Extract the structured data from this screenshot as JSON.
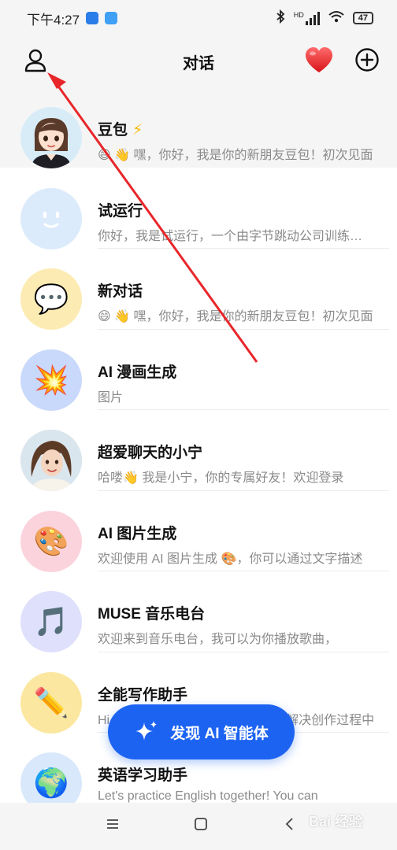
{
  "status_bar": {
    "time": "下午4:27",
    "network_label": "HD",
    "battery": "47"
  },
  "header": {
    "title": "对话"
  },
  "chats": [
    {
      "name": "豆包",
      "badge": "⚡",
      "preview": "😄 👋 嘿，你好，我是你的新朋友豆包！初次见面",
      "avatar_icon": "doubao-avatar",
      "avatar_bg": "#d8ecf8",
      "pinned": true
    },
    {
      "name": "试运行",
      "preview": "你好，我是试运行，一个由字节跳动公司训练的语言模型",
      "avatar_icon": "smile-face-icon",
      "avatar_bg": "#dcebfb"
    },
    {
      "name": "新对话",
      "preview": "😄 👋 嘿，你好，我是你的新朋友豆包！初次见面",
      "avatar_icon": "chat-bubble-icon",
      "avatar_glyph": "💬",
      "avatar_bg": "#fcebb2"
    },
    {
      "name": "AI 漫画生成",
      "preview": "图片",
      "avatar_icon": "boom-icon",
      "avatar_glyph": "💥",
      "avatar_bg": "#c9d9fb"
    },
    {
      "name": "超爱聊天的小宁",
      "preview": "哈喽👋 我是小宁，你的专属好友！欢迎登录",
      "avatar_icon": "xiaoning-avatar",
      "avatar_bg": "#e9dccd"
    },
    {
      "name": "AI 图片生成",
      "preview": "欢迎使用 AI 图片生成 🎨，你可以通过文字描述",
      "avatar_icon": "palette-icon",
      "avatar_glyph": "🎨",
      "avatar_bg": "#fbd3dd"
    },
    {
      "name": "MUSE 音乐电台",
      "preview": "欢迎来到音乐电台，我可以为你播放歌曲，",
      "avatar_icon": "music-note-icon",
      "avatar_glyph": "🎵",
      "avatar_bg": "#dfe0fb"
    },
    {
      "name": "全能写作助手",
      "preview": "Hi，我是全能写作助手，可以帮你解决创作过程中",
      "avatar_icon": "pencil-icon",
      "avatar_glyph": "✏️",
      "avatar_bg": "#fbe7a0"
    },
    {
      "name": "英语学习助手",
      "preview": "Let's practice English together! You can",
      "avatar_icon": "globe-icon",
      "avatar_glyph": "🌍",
      "avatar_bg": "#d9e8fb"
    }
  ],
  "discover_button": {
    "label": "发现 AI 智能体"
  },
  "watermark": "Bai 经验",
  "colors": {
    "accent": "#1c63f2",
    "annotation": "#e8262a",
    "heart": "#e8262a",
    "badge": "#f5b800"
  }
}
